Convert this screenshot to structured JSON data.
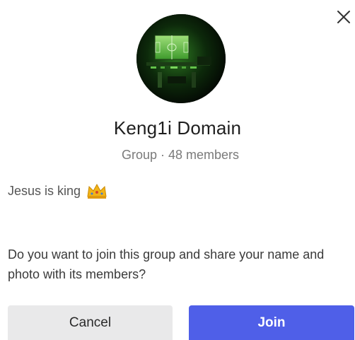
{
  "group": {
    "name": "Keng1i Domain",
    "meta": "Group · 48 members",
    "description": "Jesus is king",
    "description_emoji": "crown-icon"
  },
  "prompt": {
    "text": "Do you want to join this group and share your name and photo with its members?"
  },
  "actions": {
    "cancel_label": "Cancel",
    "join_label": "Join"
  },
  "colors": {
    "join_bg": "#4f5fe8",
    "cancel_bg": "#e9e9ea",
    "meta_text": "#7a7a7a"
  },
  "icons": {
    "close": "close-icon",
    "crown": "crown-icon",
    "avatar": "group-avatar"
  }
}
